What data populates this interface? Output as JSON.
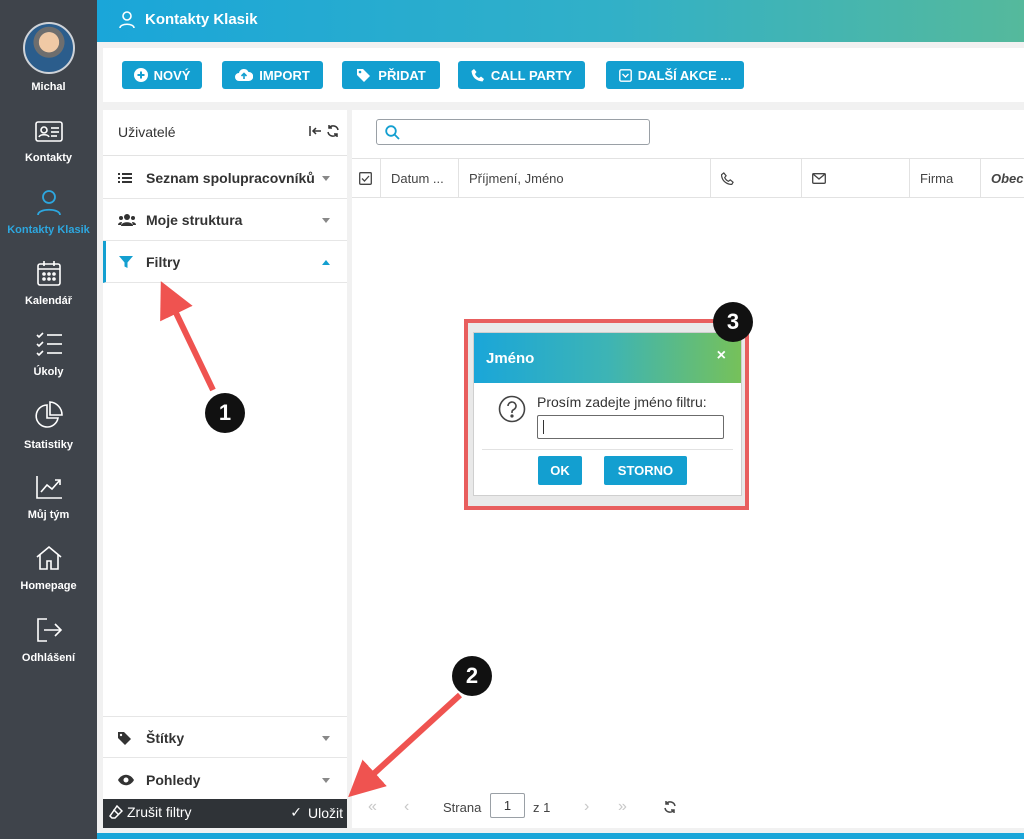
{
  "sidebar_nav": {
    "user_name": "Michal",
    "items": [
      {
        "label": "Kontakty",
        "icon": "contact-card-icon"
      },
      {
        "label": "Kontakty Klasik",
        "icon": "user-icon",
        "active": true
      },
      {
        "label": "Kalendář",
        "icon": "calendar-icon"
      },
      {
        "label": "Úkoly",
        "icon": "task-list-icon"
      },
      {
        "label": "Statistiky",
        "icon": "pie-chart-icon"
      },
      {
        "label": "Můj tým",
        "icon": "trend-chart-icon"
      },
      {
        "label": "Homepage",
        "icon": "home-icon"
      },
      {
        "label": "Odhlášení",
        "icon": "logout-icon"
      }
    ]
  },
  "header": {
    "title": "Kontakty Klasik"
  },
  "toolbar": {
    "new_label": "NOVÝ",
    "import_label": "IMPORT",
    "add_label": "PŘIDAT",
    "call_party_label": "CALL PARTY",
    "more_label": "DALŠÍ AKCE ..."
  },
  "left_panel": {
    "title": "Uživatelé",
    "sections": [
      {
        "label": "Seznam spolupracovníků",
        "icon": "list-icon"
      },
      {
        "label": "Moje struktura",
        "icon": "users-icon"
      },
      {
        "label": "Filtry",
        "icon": "filter-icon",
        "expanded": true
      },
      {
        "label": "Štítky",
        "icon": "tag-icon"
      },
      {
        "label": "Pohledy",
        "icon": "eye-icon"
      }
    ],
    "clear_filters_label": "Zrušit filtry",
    "save_label": "Uložit"
  },
  "grid": {
    "search_placeholder": "",
    "columns": [
      "Datum ...",
      "Příjmení, Jméno",
      "Firma",
      "Obec"
    ],
    "pager": {
      "page_label": "Strana",
      "current_page": "1",
      "of_label": "z 1"
    }
  },
  "dialog": {
    "title": "Jméno",
    "close_glyph": "×",
    "prompt": "Prosím zadejte jméno filtru:",
    "ok_label": "OK",
    "cancel_label": "STORNO"
  },
  "annotations": {
    "badge1": "1",
    "badge2": "2",
    "badge3": "3"
  },
  "colors": {
    "accent": "#139fd0",
    "nav_bg": "#3f444b",
    "highlight": "#e85e5e"
  }
}
